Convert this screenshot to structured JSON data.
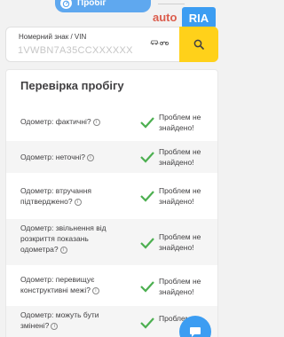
{
  "header": {
    "tab_label": "Пробіг",
    "logo_auto": "auto",
    "logo_ria": "RIA"
  },
  "search": {
    "caption": "Номерний знак / VIN",
    "placeholder": "1VWBN7A35CCXXXXXX",
    "button_icon": "search-icon"
  },
  "card": {
    "title": "Перевірка пробігу",
    "rows": [
      {
        "question": "Одометр: фактичні?",
        "result": "Проблем не знайдено!"
      },
      {
        "question": "Одометр: неточні?",
        "result": "Проблем не знайдено!"
      },
      {
        "question": "Одометр: втручання підтверджено?",
        "result": "Проблем не знайдено!"
      },
      {
        "question": "Одометр: звільнення від розкриття показань одометра?",
        "result": "Проблем не знайдено!"
      },
      {
        "question": "Одометр: перевищує конструктивні межі?",
        "result": "Проблем не знайдено!"
      },
      {
        "question": "Одометр: можуть бути змінені?",
        "result": "Проблем"
      }
    ]
  },
  "colors": {
    "accent_blue": "#3c9df2",
    "search_yellow": "#ffd11a",
    "check_green": "#4caf50",
    "logo_red": "#db5c4c"
  }
}
